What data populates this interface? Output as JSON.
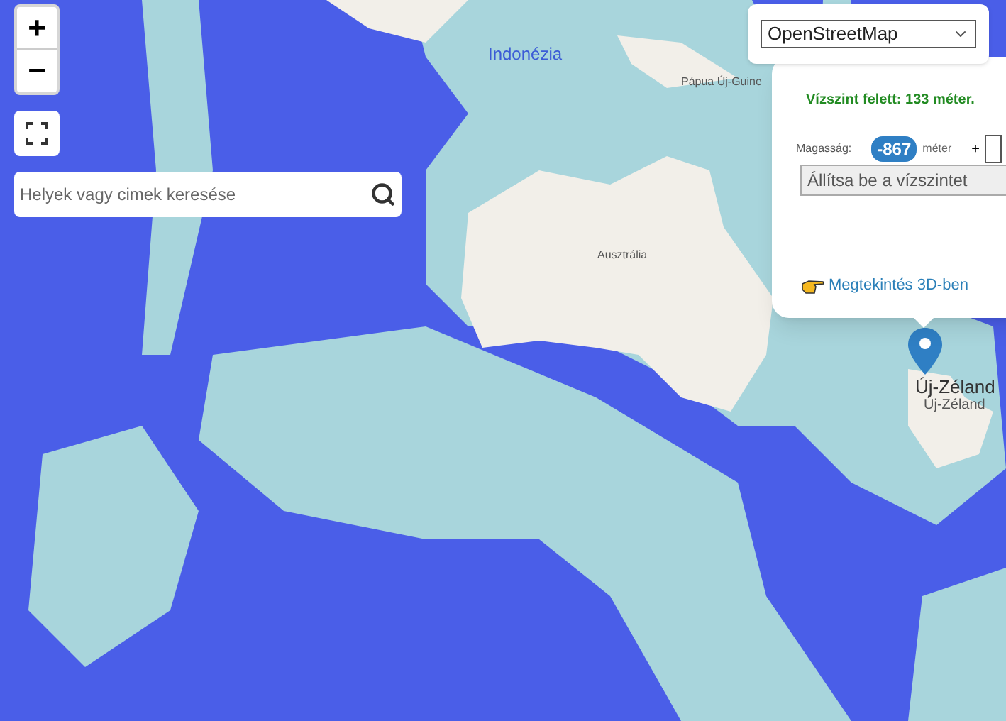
{
  "map": {
    "labels": [
      {
        "text": "Indonézia",
        "kind": "country"
      },
      {
        "text": "Pápua Új-Guine",
        "kind": "region"
      },
      {
        "text": "Ausztrália",
        "kind": "region"
      },
      {
        "text": "Új-Zéland",
        "kind": "marker"
      },
      {
        "text": "Új-Zéland",
        "kind": "place"
      }
    ]
  },
  "controls": {
    "zoom_in": "+",
    "zoom_out": "−"
  },
  "search": {
    "placeholder": "Helyek vagy cimek keresése"
  },
  "layer_select": {
    "value": "OpenStreetMap"
  },
  "popup": {
    "status": "Vízszint felett: 133 méter.",
    "height_label": "Magasság:",
    "height_value": "-867",
    "unit": "méter",
    "plus": "+",
    "set_button": "Állítsa be a vízszintet",
    "link": "Megtekintés 3D-ben"
  }
}
